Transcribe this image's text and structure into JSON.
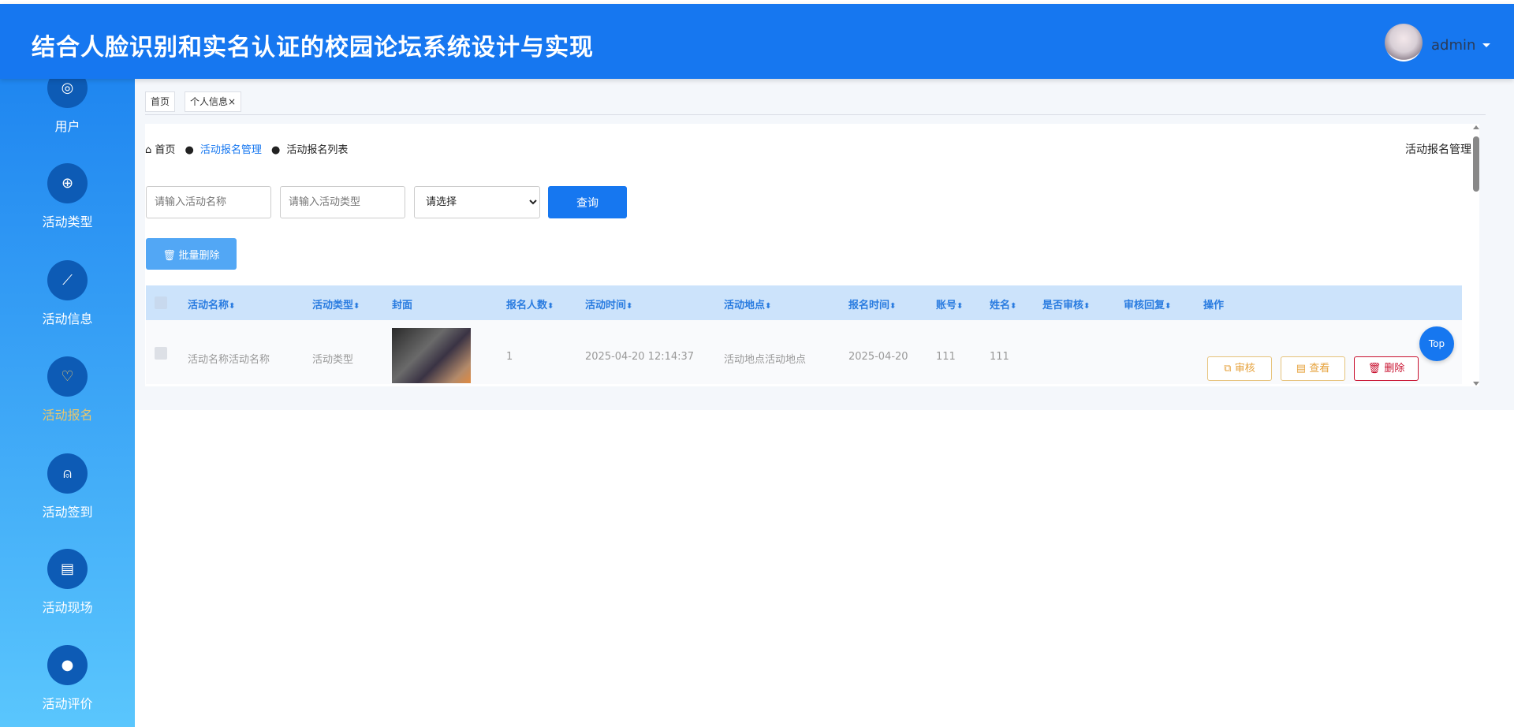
{
  "header": {
    "title": "结合人脸识别和实名认证的校园论坛系统设计与实现",
    "username": "admin"
  },
  "sidebar": {
    "items": [
      {
        "label": "用户",
        "icon": "search-icon",
        "glyph": "◎"
      },
      {
        "label": "活动类型",
        "icon": "plus-circle-icon",
        "glyph": "⊕"
      },
      {
        "label": "活动信息",
        "icon": "chart-icon",
        "glyph": "⟋"
      },
      {
        "label": "活动报名",
        "icon": "heart-plus-icon",
        "glyph": "♡"
      },
      {
        "label": "活动签到",
        "icon": "user-check-icon",
        "glyph": "⍝"
      },
      {
        "label": "活动现场",
        "icon": "notepad-icon",
        "glyph": "▤"
      },
      {
        "label": "活动评价",
        "icon": "comment-icon",
        "glyph": "●"
      }
    ],
    "active": 3
  },
  "tabs": [
    {
      "label": "首页"
    },
    {
      "label": "个人信息",
      "close": "×"
    }
  ],
  "breadcrumb": {
    "home": "首页",
    "section": "活动报名管理",
    "page": "活动报名列表",
    "dot": "●"
  },
  "page_title": "活动报名管理",
  "search": {
    "name_placeholder": "请输入活动名称",
    "type_placeholder": "请输入活动类型",
    "select_value": "请选择",
    "query_label": "查询"
  },
  "batch_delete_label": "批量删除",
  "table": {
    "headers": [
      "活动名称",
      "活动类型",
      "封面",
      "报名人数",
      "活动时间",
      "活动地点",
      "报名时间",
      "账号",
      "姓名",
      "是否审核",
      "审核回复",
      "操作"
    ],
    "sortable": [
      true,
      true,
      false,
      true,
      true,
      true,
      true,
      true,
      true,
      true,
      true,
      false
    ],
    "sort_glyph": "⬍",
    "rows": [
      {
        "name": "活动名称活动名称",
        "type": "活动类型",
        "count": "1",
        "time": "2025-04-20 12:14:37",
        "place": "活动地点活动地点",
        "signup_time": "2025-04-20",
        "account": "111",
        "realname": "111",
        "audited": "",
        "reply": ""
      }
    ],
    "actions": {
      "audit": "审核",
      "view": "查看",
      "delete": "删除"
    }
  },
  "top_label": "Top",
  "colors": {
    "primary": "#1677f0",
    "warning": "#e6a23c",
    "danger": "#c8102e",
    "active": "#e8c66d"
  }
}
